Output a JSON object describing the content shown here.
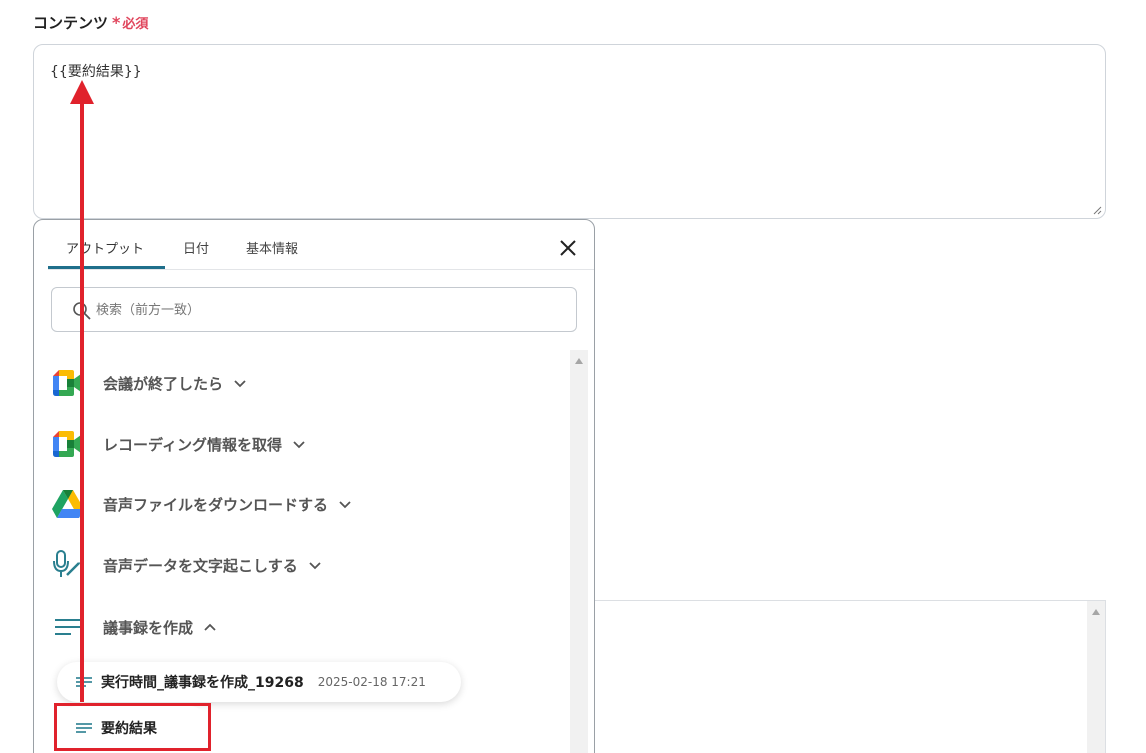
{
  "form": {
    "label": "コンテンツ",
    "required_mark": "*",
    "required_text": "必須",
    "content_value": "{{要約結果}}"
  },
  "panel": {
    "tabs": [
      {
        "label": "アウトプット",
        "active": true
      },
      {
        "label": "日付",
        "active": false
      },
      {
        "label": "基本情報",
        "active": false
      }
    ],
    "close_icon": "close-icon",
    "search": {
      "placeholder": "検索（前方一致）",
      "value": ""
    },
    "groups": [
      {
        "label": "会議が終了したら",
        "icon": "google-meet-icon",
        "expanded": false
      },
      {
        "label": "レコーディング情報を取得",
        "icon": "google-meet-icon",
        "expanded": false
      },
      {
        "label": "音声ファイルをダウンロードする",
        "icon": "google-drive-icon",
        "expanded": false
      },
      {
        "label": "音声データを文字起こしする",
        "icon": "microphone-icon",
        "expanded": false
      },
      {
        "label": "議事録を作成",
        "icon": "text-lines-icon",
        "expanded": true
      }
    ],
    "outputs": [
      {
        "name": "実行時間_議事録を作成_19268",
        "time": "2025-02-18 17:21"
      },
      {
        "name": "要約結果"
      }
    ]
  },
  "colors": {
    "accent": "#1f6f8b",
    "required": "#e0455c",
    "annotation": "#e0222c"
  }
}
